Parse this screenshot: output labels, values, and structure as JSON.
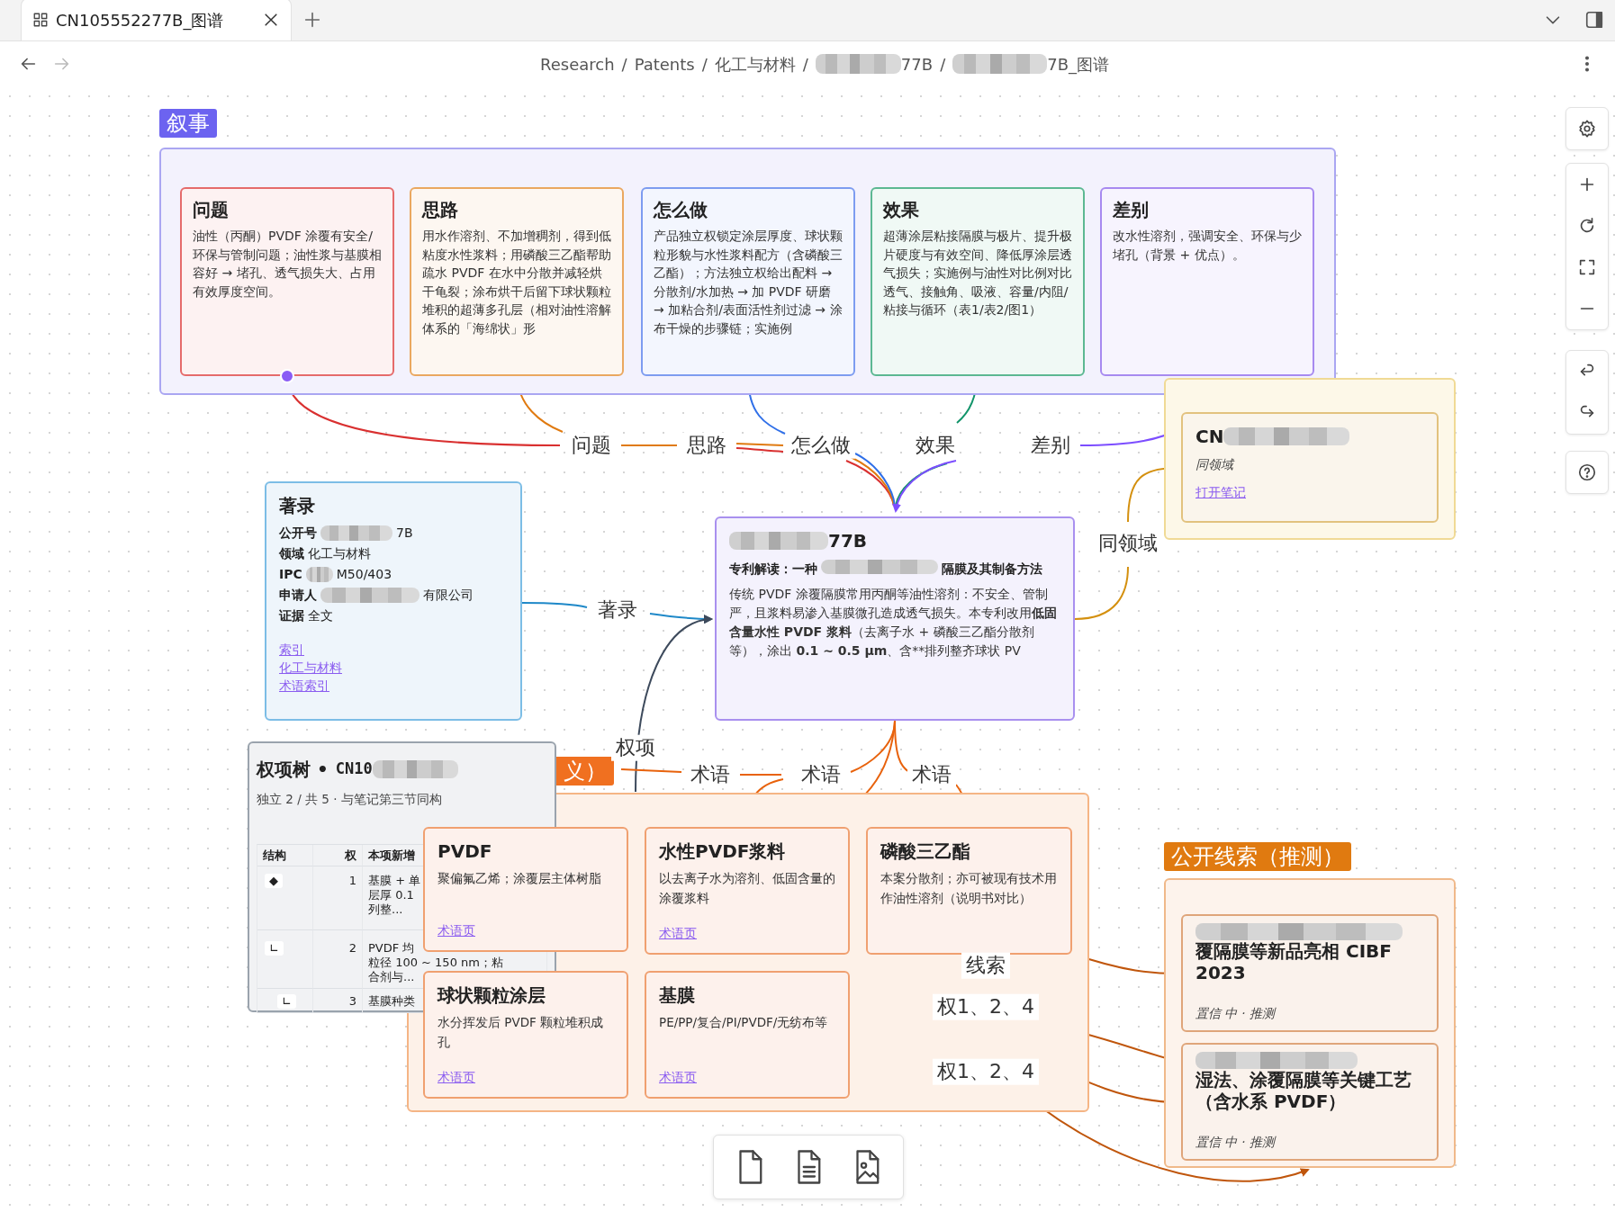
{
  "tab": {
    "title": "CN105552277B_图谱"
  },
  "breadcrumb": {
    "separator": "/",
    "items": [
      {
        "text": "Research",
        "redacted": false
      },
      {
        "text": "Patents",
        "redacted": false
      },
      {
        "text": "化工与材料",
        "redacted": false
      },
      {
        "text": "77B",
        "redacted": true
      },
      {
        "text": "7B_图谱",
        "redacted": true
      }
    ]
  },
  "narrative": {
    "label": "叙事",
    "cards": [
      {
        "title": "问题",
        "text": "油性（丙酮）PVDF 涂覆有安全/环保与管制问题；油性浆与基膜相容好 → 堵孔、透气损失大、占用有效厚度空间。",
        "color": "#e56b6b"
      },
      {
        "title": "思路",
        "text": "用水作溶剂、不加增稠剂，得到低粘度水性浆料；用磷酸三乙酯帮助疏水 PVDF 在水中分散并减轻烘干龟裂；涂布烘干后留下球状颗粒堆积的超薄多孔层（相对油性溶解体系的「海绵状」形",
        "color": "#eaa860"
      },
      {
        "title": "怎么做",
        "text": "产品独立权锁定涂层厚度、球状颗粒形貌与水性浆料配方（含磷酸三乙酯）；方法独立权给出配料 → 分散剂/水加热 → 加 PVDF 研磨 → 加粘合剂/表面活性剂过滤 → 涂布干燥的步骤链；实施例",
        "color": "#7d9cf0"
      },
      {
        "title": "效果",
        "text": "超薄涂层粘接隔膜与极片、提升极片硬度与有效空间、降低厚涂层透气损失；实施例与油性对比例对比透气、接触角、吸液、容量/内阻/粘接与循环（表1/表2/图1）",
        "color": "#5cb892"
      },
      {
        "title": "差别",
        "text": "改水性溶剂，强调安全、环保与少堵孔（背景 + 优点）。",
        "color": "#a78af0"
      }
    ]
  },
  "edge_labels": [
    "问题",
    "思路",
    "怎么做",
    "效果",
    "差别",
    "著录",
    "同领域",
    "权项",
    "术语",
    "术语",
    "术语",
    "线索",
    "权1、2、4",
    "权1、2、4"
  ],
  "bibliography": {
    "title": "著录",
    "fields": [
      {
        "label": "公开号",
        "value": "7B",
        "redacted": true
      },
      {
        "label": "领域",
        "value": "化工与材料",
        "redacted": false
      },
      {
        "label": "IPC",
        "value": "M50/403",
        "redacted": true
      },
      {
        "label": "申请人",
        "value": "有限公司",
        "redacted": true
      },
      {
        "label": "证据",
        "value": "全文",
        "redacted": false
      }
    ],
    "links": [
      "索引",
      "化工与材料",
      "术语索引"
    ]
  },
  "summary": {
    "number": "77B",
    "subtitle_parts": [
      "专利解读：一种",
      "隔膜及其制备方法"
    ],
    "body": [
      {
        "text": "传统 PVDF 涂覆隔膜常用丙酮等油性溶剂：不安全、管制严，且浆料易渗入基膜微孔造成透气损失。本专利改用",
        "bold": false
      },
      {
        "text": "低固含量水性 PVDF 浆料",
        "bold": true
      },
      {
        "text": "（去离子水 + 磷酸三乙酯分散剂等），涂出 ",
        "bold": false
      },
      {
        "text": "0.1 ~ 0.5 µm",
        "bold": true
      },
      {
        "text": "、含**排列整齐球状 PV",
        "bold": false
      }
    ]
  },
  "same_field": {
    "title": "CN",
    "note": "同领域",
    "link": "打开笔记"
  },
  "claim_tree": {
    "title": "权项树 •",
    "number": "CN10",
    "meta": "独立 2 / 共 5 · 与笔记第三节同构",
    "columns": [
      "结构",
      "权",
      "本项新增"
    ],
    "rows": [
      {
        "structure": "◆",
        "claim": "1",
        "lines": [
          "基膜 + 单",
          "层厚 0.1",
          "列整..."
        ]
      },
      {
        "structure": "∟",
        "claim": "2",
        "lines": [
          "PVDF 均",
          "粒径 100 ~ 150 nm；粘",
          "合剂与..."
        ]
      },
      {
        "structure": "∟",
        "claim": "3",
        "lines": [
          "基膜种类"
        ]
      }
    ]
  },
  "terms": {
    "label": "义）",
    "cards": [
      {
        "title": "PVDF",
        "text": "聚偏氟乙烯；涂覆层主体树脂",
        "link": "术语页"
      },
      {
        "title": "水性PVDF浆料",
        "text": "以去离子水为溶剂、低固含量的涂覆浆料",
        "link": "术语页"
      },
      {
        "title": "磷酸三乙酯",
        "text": "本案分散剂；亦可被现有技术用作油性溶剂（说明书对比）"
      },
      {
        "title": "球状颗粒涂层",
        "text": "水分挥发后 PVDF 颗粒堆积成孔",
        "link": "术语页"
      },
      {
        "title": "基膜",
        "text": "PE/PP/复合/PI/PVDF/无纺布等",
        "link": "术语页"
      }
    ]
  },
  "clues": {
    "label": "公开线索（推测）",
    "cards": [
      {
        "title": "覆隔膜等新品亮相 CIBF 2023",
        "meta": "置信 中 · 推测"
      },
      {
        "title": "湿法、涂覆隔膜等关键工艺（含水系 PVDF）",
        "meta": "置信 中 · 推测"
      }
    ]
  }
}
